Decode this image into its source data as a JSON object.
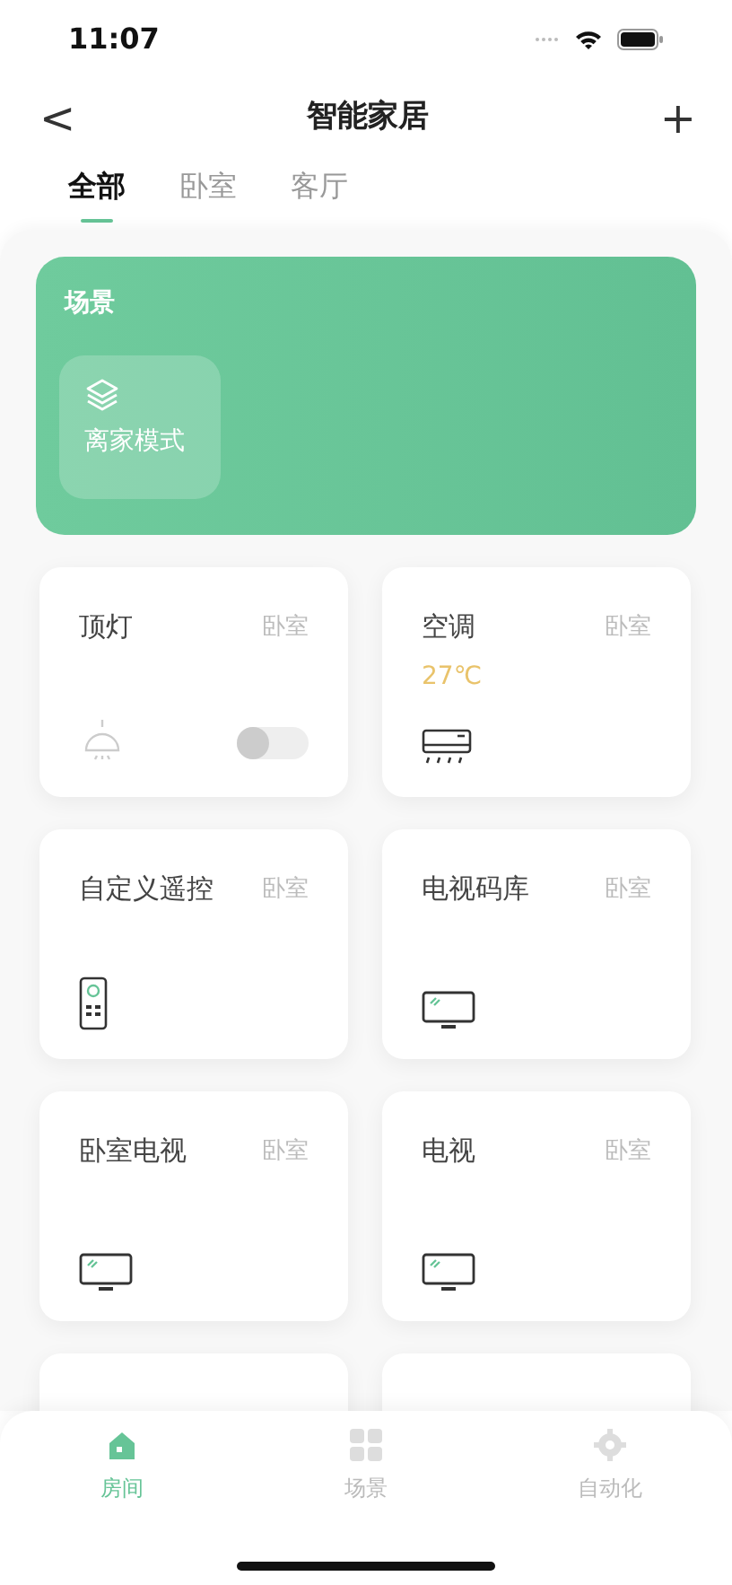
{
  "status_bar": {
    "time": "11:07"
  },
  "header": {
    "back": "<",
    "title": "智能家居",
    "add": "+"
  },
  "tabs": [
    {
      "label": "全部",
      "selected": true
    },
    {
      "label": "卧室",
      "selected": false
    },
    {
      "label": "客厅",
      "selected": false
    }
  ],
  "scenes": {
    "title": "场景",
    "items": [
      {
        "label": "离家模式"
      }
    ]
  },
  "devices": [
    {
      "name": "顶灯",
      "room": "卧室",
      "kind": "light",
      "on": false
    },
    {
      "name": "空调",
      "room": "卧室",
      "kind": "ac",
      "reading": "27℃"
    },
    {
      "name": "自定义遥控",
      "room": "卧室",
      "kind": "remote"
    },
    {
      "name": "电视码库",
      "room": "卧室",
      "kind": "tv"
    },
    {
      "name": "卧室电视",
      "room": "卧室",
      "kind": "tv"
    },
    {
      "name": "电视",
      "room": "卧室",
      "kind": "tv"
    },
    {
      "kind": "cut"
    },
    {
      "kind": "cut"
    }
  ],
  "bottom_nav": [
    {
      "label": "房间",
      "kind": "home",
      "selected": true
    },
    {
      "label": "场景",
      "kind": "grid",
      "selected": false
    },
    {
      "label": "自动化",
      "kind": "gear",
      "selected": false
    }
  ]
}
